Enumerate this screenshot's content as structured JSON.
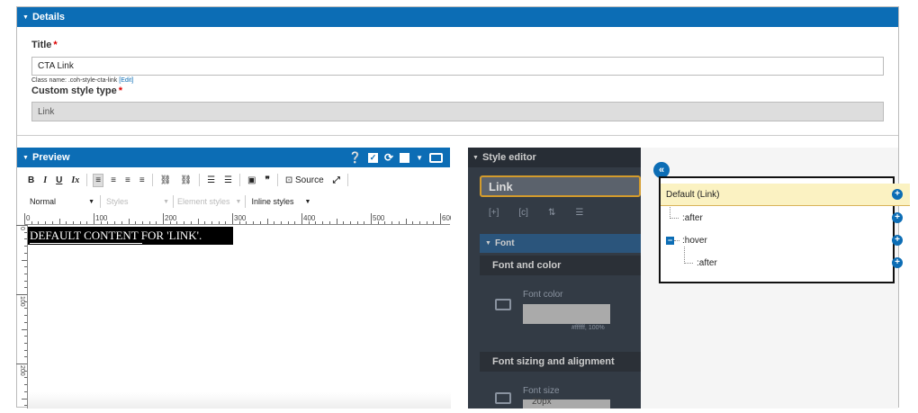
{
  "details": {
    "header": "Details",
    "title_label": "Title",
    "title_value": "CTA Link",
    "class_name_text": "Class name: .coh-style-cta-link",
    "edit_link": "[Edit]",
    "style_type_label": "Custom style type",
    "style_type_value": "Link"
  },
  "preview": {
    "header": "Preview",
    "toolbar": {
      "bold": "B",
      "italic": "I",
      "underline": "U",
      "clear_format": "Ix",
      "source": "Source",
      "format_select": "Normal",
      "styles_select": "Styles",
      "element_styles_select": "Element styles",
      "inline_styles_select": "Inline styles"
    },
    "ruler_labels": [
      "0",
      "100",
      "200",
      "300",
      "400",
      "500",
      "600"
    ],
    "vruler_labels": [
      "0",
      "100",
      "200"
    ],
    "canvas_text": "DEFAULT CONTENT FOR 'LINK'."
  },
  "style_editor": {
    "header": "Style editor",
    "style_name": "Link",
    "font_header": "Font",
    "section_font_color": "Font and color",
    "font_color_label": "Font color",
    "font_color_value": "#ffffff, 100%",
    "section_font_sizing": "Font sizing and alignment",
    "font_size_label": "Font size",
    "font_size_value": "20px"
  },
  "tree": {
    "items": [
      {
        "label": "Default (Link)"
      },
      {
        "label": ":after"
      },
      {
        "label": ":hover"
      },
      {
        "label": ":after"
      }
    ]
  },
  "colors": {
    "accent": "#0c6db5",
    "selected_row": "#fbf2c2",
    "editor_dark": "#333b45"
  }
}
